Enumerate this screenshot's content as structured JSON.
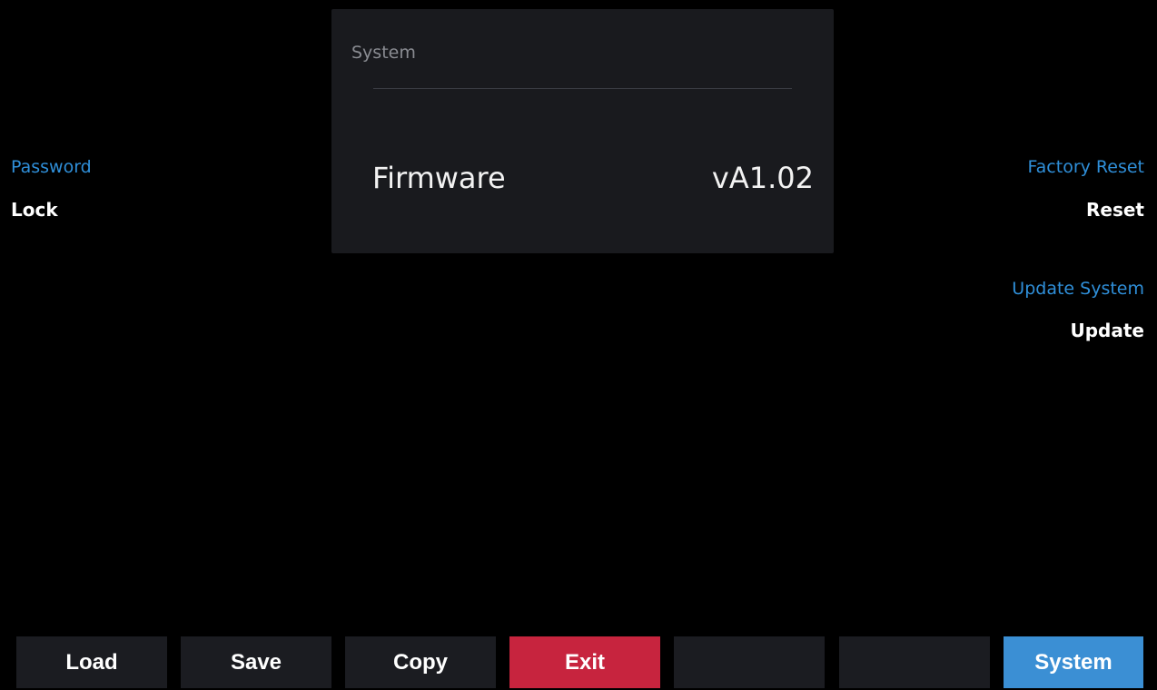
{
  "panel": {
    "title": "System",
    "firmware_label": "Firmware",
    "firmware_value": "vA1.02"
  },
  "left_menu": {
    "password_label": "Password",
    "password_action": "Lock"
  },
  "right_menu": {
    "factory_reset_label": "Factory Reset",
    "factory_reset_action": "Reset",
    "update_label": "Update System",
    "update_action": "Update"
  },
  "softkeys": {
    "load": "Load",
    "save": "Save",
    "copy": "Copy",
    "exit": "Exit",
    "blank1": "",
    "blank2": "",
    "system": "System"
  },
  "colors": {
    "accent_blue": "#2f8fd9",
    "exit_red": "#c7243e",
    "active_blue": "#3b8fd4",
    "panel_bg": "#191a1e"
  }
}
